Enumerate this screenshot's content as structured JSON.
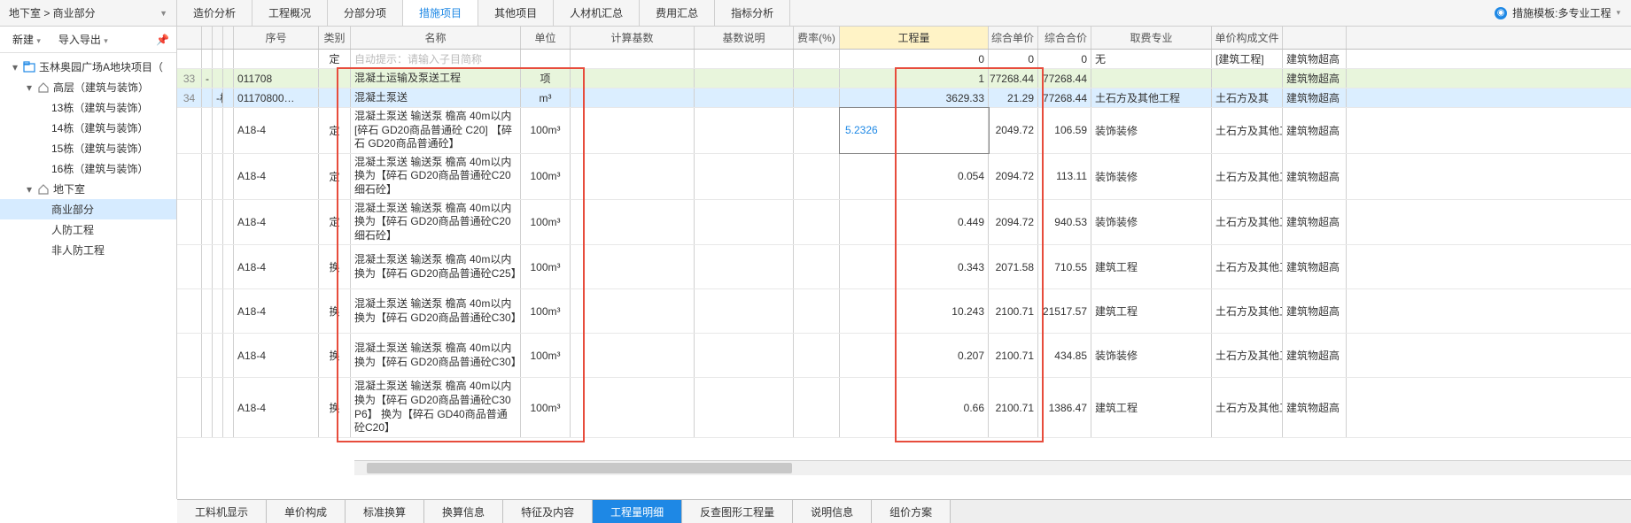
{
  "breadcrumb": "地下室 > 商业部分",
  "tabs": [
    "造价分析",
    "工程概况",
    "分部分项",
    "措施项目",
    "其他项目",
    "人材机汇总",
    "费用汇总",
    "指标分析"
  ],
  "active_tab_index": 3,
  "right_template": "措施模板:多专业工程",
  "left_toolbar": {
    "new": "新建",
    "import_export": "导入导出"
  },
  "tree": {
    "root": "玉林奥园广场A地块项目（",
    "items": [
      {
        "label": "高层（建筑与装饰）",
        "indent": 1,
        "expand": true,
        "icon": "home"
      },
      {
        "label": "13栋（建筑与装饰）",
        "indent": 2
      },
      {
        "label": "14栋（建筑与装饰）",
        "indent": 2
      },
      {
        "label": "15栋（建筑与装饰）",
        "indent": 2
      },
      {
        "label": "16栋（建筑与装饰）",
        "indent": 2
      },
      {
        "label": "地下室",
        "indent": 1,
        "expand": true,
        "icon": "home"
      },
      {
        "label": "商业部分",
        "indent": 2,
        "selected": true
      },
      {
        "label": "人防工程",
        "indent": 2
      },
      {
        "label": "非人防工程",
        "indent": 2
      }
    ]
  },
  "columns": {
    "seq": "序号",
    "type": "类别",
    "name": "名称",
    "unit": "单位",
    "calc_base": "计算基数",
    "base_desc": "基数说明",
    "rate": "费率(%)",
    "qty": "工程量",
    "unit_price": "综合单价",
    "total": "综合合价",
    "fee_major": "取费专业",
    "file": "单价构成文件",
    "extra": ""
  },
  "placeholder_row": {
    "type": "定",
    "name_placeholder": "自动提示：请输入子目简称",
    "qty": "0",
    "unit_price": "0",
    "total": "0",
    "fee_major": "无",
    "file": "[建筑工程]",
    "extra": "建筑物超高"
  },
  "rows": [
    {
      "idx": "33",
      "t1": "-",
      "code": "011708",
      "name": "混凝土运输及泵送工程",
      "unit": "项",
      "qty": "1",
      "unit_price": "77268.44",
      "total": "77268.44",
      "file": "",
      "extra": "建筑物超高",
      "style": "green"
    },
    {
      "idx": "34",
      "t2": "-",
      "t2label": "桂",
      "code": "01170800…",
      "name": "混凝土泵送",
      "unit": "m³",
      "qty": "3629.33",
      "unit_price": "21.29",
      "total": "77268.44",
      "fee_major": "土石方及其他工程",
      "file": "土石方及其",
      "extra": "建筑物超高",
      "style": "blue"
    },
    {
      "code": "A18-4",
      "type": "定",
      "name": "混凝土泵送 输送泵 檐高 40m以内 [碎石 GD20商品普通砼 C20] 【碎石 GD20商品普通砼】",
      "unit": "100m³",
      "qty_edit": "5.2326",
      "unit_price": "2049.72",
      "total": "106.59",
      "fee_major": "装饰装修",
      "file": "土石方及其他工程",
      "extra": "建筑物超高",
      "tall": true
    },
    {
      "code": "A18-4",
      "type": "定",
      "name": "混凝土泵送 输送泵 檐高 40m以内  换为【碎石 GD20商品普通砼C20 细石砼】",
      "unit": "100m³",
      "qty": "0.054",
      "unit_price": "2094.72",
      "total": "113.11",
      "fee_major": "装饰装修",
      "file": "土石方及其他工程",
      "extra": "建筑物超高",
      "tall": true
    },
    {
      "code": "A18-4",
      "type": "定",
      "name": "混凝土泵送 输送泵 檐高 40m以内  换为【碎石 GD20商品普通砼C20 细石砼】",
      "unit": "100m³",
      "qty": "0.449",
      "unit_price": "2094.72",
      "total": "940.53",
      "fee_major": "装饰装修",
      "file": "土石方及其他工程",
      "extra": "建筑物超高",
      "tall": true
    },
    {
      "code": "A18-4",
      "type": "换",
      "name": "混凝土泵送 输送泵 檐高 40m以内  换为【碎石 GD20商品普通砼C25】",
      "unit": "100m³",
      "qty": "0.343",
      "unit_price": "2071.58",
      "total": "710.55",
      "fee_major": "建筑工程",
      "file": "土石方及其他工程",
      "extra": "建筑物超高",
      "tall": true
    },
    {
      "code": "A18-4",
      "type": "换",
      "name": "混凝土泵送 输送泵 檐高 40m以内  换为【碎石 GD20商品普通砼C30】",
      "unit": "100m³",
      "qty": "10.243",
      "unit_price": "2100.71",
      "total": "21517.57",
      "fee_major": "建筑工程",
      "file": "土石方及其他工程",
      "extra": "建筑物超高",
      "tall": true
    },
    {
      "code": "A18-4",
      "type": "换",
      "name": "混凝土泵送 输送泵 檐高 40m以内  换为【碎石 GD20商品普通砼C30】",
      "unit": "100m³",
      "qty": "0.207",
      "unit_price": "2100.71",
      "total": "434.85",
      "fee_major": "装饰装修",
      "file": "土石方及其他工程",
      "extra": "建筑物超高",
      "tall": true
    },
    {
      "code": "A18-4",
      "type": "换",
      "name": "混凝土泵送 输送泵 檐高 40m以内  换为【碎石 GD20商品普通砼C30 P6】  换为【碎石 GD40商品普通砼C20】",
      "unit": "100m³",
      "qty": "0.66",
      "unit_price": "2100.71",
      "total": "1386.47",
      "fee_major": "建筑工程",
      "file": "土石方及其他工程",
      "extra": "建筑物超高",
      "tall": true
    }
  ],
  "bottom_tabs": [
    "工料机显示",
    "单价构成",
    "标准换算",
    "换算信息",
    "特征及内容",
    "工程量明细",
    "反查图形工程量",
    "说明信息",
    "组价方案"
  ],
  "bottom_active_index": 5
}
